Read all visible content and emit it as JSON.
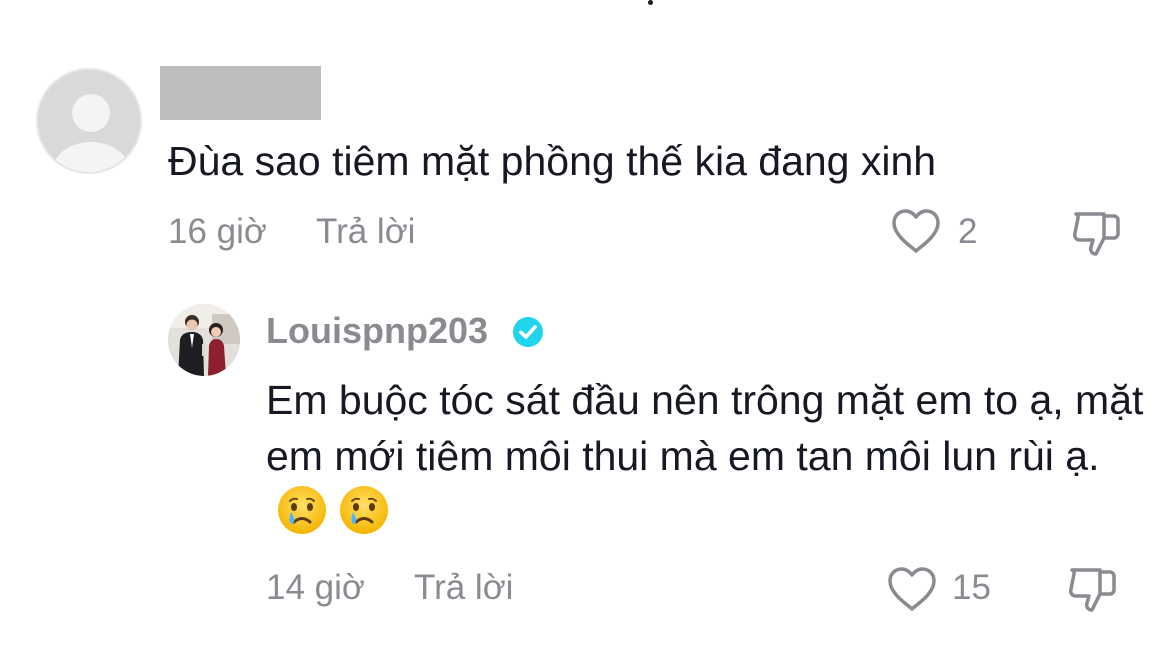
{
  "comments": [
    {
      "username": "",
      "text": "Đùa sao tiêm mặt phồng thế kia đang xinh",
      "time": "16 giờ",
      "reply_label": "Trả lời",
      "likes": "2",
      "avatar": "default-avatar"
    }
  ],
  "reply": {
    "username": "Louispnp203",
    "verified": true,
    "text": "Em buộc tóc sát đầu nên trông mặt em to ạ, mặt em mới tiêm môi thui mà em tan môi lun rùi ạ.",
    "emojis": [
      "crying-face-icon",
      "crying-face-icon"
    ],
    "time": "14 giờ",
    "reply_label": "Trả lời",
    "likes": "15",
    "avatar": "profile-photo"
  },
  "icons": {
    "like": "heart-outline-icon",
    "dislike": "thumbs-down-outline-icon",
    "verified": "verified-badge-icon"
  },
  "colors": {
    "primary_text": "#161823",
    "secondary_text": "#8a8b91",
    "verified_badge": "#20d5ec",
    "redaction": "#bdbdbd"
  }
}
